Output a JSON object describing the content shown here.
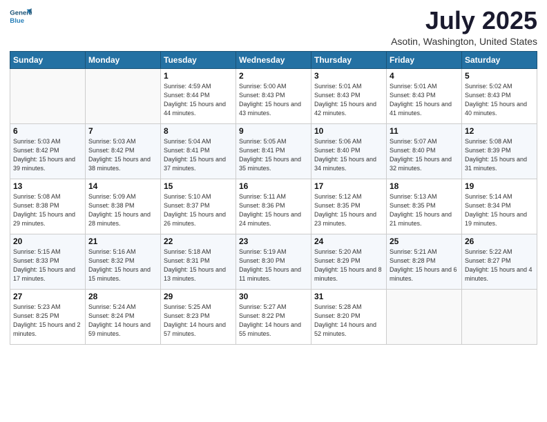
{
  "header": {
    "logo_line1": "General",
    "logo_line2": "Blue",
    "title": "July 2025",
    "subtitle": "Asotin, Washington, United States"
  },
  "weekdays": [
    "Sunday",
    "Monday",
    "Tuesday",
    "Wednesday",
    "Thursday",
    "Friday",
    "Saturday"
  ],
  "weeks": [
    [
      {
        "day": "",
        "info": ""
      },
      {
        "day": "",
        "info": ""
      },
      {
        "day": "1",
        "info": "Sunrise: 4:59 AM\nSunset: 8:44 PM\nDaylight: 15 hours and 44 minutes."
      },
      {
        "day": "2",
        "info": "Sunrise: 5:00 AM\nSunset: 8:43 PM\nDaylight: 15 hours and 43 minutes."
      },
      {
        "day": "3",
        "info": "Sunrise: 5:01 AM\nSunset: 8:43 PM\nDaylight: 15 hours and 42 minutes."
      },
      {
        "day": "4",
        "info": "Sunrise: 5:01 AM\nSunset: 8:43 PM\nDaylight: 15 hours and 41 minutes."
      },
      {
        "day": "5",
        "info": "Sunrise: 5:02 AM\nSunset: 8:43 PM\nDaylight: 15 hours and 40 minutes."
      }
    ],
    [
      {
        "day": "6",
        "info": "Sunrise: 5:03 AM\nSunset: 8:42 PM\nDaylight: 15 hours and 39 minutes."
      },
      {
        "day": "7",
        "info": "Sunrise: 5:03 AM\nSunset: 8:42 PM\nDaylight: 15 hours and 38 minutes."
      },
      {
        "day": "8",
        "info": "Sunrise: 5:04 AM\nSunset: 8:41 PM\nDaylight: 15 hours and 37 minutes."
      },
      {
        "day": "9",
        "info": "Sunrise: 5:05 AM\nSunset: 8:41 PM\nDaylight: 15 hours and 35 minutes."
      },
      {
        "day": "10",
        "info": "Sunrise: 5:06 AM\nSunset: 8:40 PM\nDaylight: 15 hours and 34 minutes."
      },
      {
        "day": "11",
        "info": "Sunrise: 5:07 AM\nSunset: 8:40 PM\nDaylight: 15 hours and 32 minutes."
      },
      {
        "day": "12",
        "info": "Sunrise: 5:08 AM\nSunset: 8:39 PM\nDaylight: 15 hours and 31 minutes."
      }
    ],
    [
      {
        "day": "13",
        "info": "Sunrise: 5:08 AM\nSunset: 8:38 PM\nDaylight: 15 hours and 29 minutes."
      },
      {
        "day": "14",
        "info": "Sunrise: 5:09 AM\nSunset: 8:38 PM\nDaylight: 15 hours and 28 minutes."
      },
      {
        "day": "15",
        "info": "Sunrise: 5:10 AM\nSunset: 8:37 PM\nDaylight: 15 hours and 26 minutes."
      },
      {
        "day": "16",
        "info": "Sunrise: 5:11 AM\nSunset: 8:36 PM\nDaylight: 15 hours and 24 minutes."
      },
      {
        "day": "17",
        "info": "Sunrise: 5:12 AM\nSunset: 8:35 PM\nDaylight: 15 hours and 23 minutes."
      },
      {
        "day": "18",
        "info": "Sunrise: 5:13 AM\nSunset: 8:35 PM\nDaylight: 15 hours and 21 minutes."
      },
      {
        "day": "19",
        "info": "Sunrise: 5:14 AM\nSunset: 8:34 PM\nDaylight: 15 hours and 19 minutes."
      }
    ],
    [
      {
        "day": "20",
        "info": "Sunrise: 5:15 AM\nSunset: 8:33 PM\nDaylight: 15 hours and 17 minutes."
      },
      {
        "day": "21",
        "info": "Sunrise: 5:16 AM\nSunset: 8:32 PM\nDaylight: 15 hours and 15 minutes."
      },
      {
        "day": "22",
        "info": "Sunrise: 5:18 AM\nSunset: 8:31 PM\nDaylight: 15 hours and 13 minutes."
      },
      {
        "day": "23",
        "info": "Sunrise: 5:19 AM\nSunset: 8:30 PM\nDaylight: 15 hours and 11 minutes."
      },
      {
        "day": "24",
        "info": "Sunrise: 5:20 AM\nSunset: 8:29 PM\nDaylight: 15 hours and 8 minutes."
      },
      {
        "day": "25",
        "info": "Sunrise: 5:21 AM\nSunset: 8:28 PM\nDaylight: 15 hours and 6 minutes."
      },
      {
        "day": "26",
        "info": "Sunrise: 5:22 AM\nSunset: 8:27 PM\nDaylight: 15 hours and 4 minutes."
      }
    ],
    [
      {
        "day": "27",
        "info": "Sunrise: 5:23 AM\nSunset: 8:25 PM\nDaylight: 15 hours and 2 minutes."
      },
      {
        "day": "28",
        "info": "Sunrise: 5:24 AM\nSunset: 8:24 PM\nDaylight: 14 hours and 59 minutes."
      },
      {
        "day": "29",
        "info": "Sunrise: 5:25 AM\nSunset: 8:23 PM\nDaylight: 14 hours and 57 minutes."
      },
      {
        "day": "30",
        "info": "Sunrise: 5:27 AM\nSunset: 8:22 PM\nDaylight: 14 hours and 55 minutes."
      },
      {
        "day": "31",
        "info": "Sunrise: 5:28 AM\nSunset: 8:20 PM\nDaylight: 14 hours and 52 minutes."
      },
      {
        "day": "",
        "info": ""
      },
      {
        "day": "",
        "info": ""
      }
    ]
  ]
}
